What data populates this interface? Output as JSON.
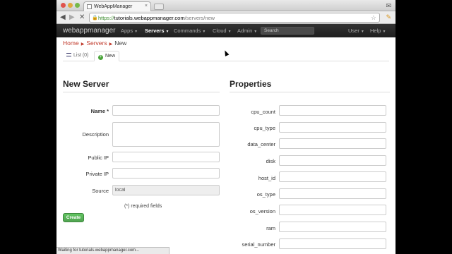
{
  "browser": {
    "tab_title": "WebAppManager",
    "tab_close": "×",
    "url_scheme": "https://",
    "url_host": "tutorials.webappmanager.com",
    "url_path": "/servers/new",
    "back_glyph": "◀",
    "forward_glyph": "▶",
    "stop_glyph": "✕",
    "lock_glyph": "🔒",
    "star_glyph": "☆",
    "ext_glyph": "✎",
    "person_glyph": "✉"
  },
  "navbar": {
    "brand": "webappmanager",
    "items": [
      {
        "label": "Apps",
        "caret": "▼",
        "active": false
      },
      {
        "label": "Servers",
        "caret": "▼",
        "active": true
      },
      {
        "label": "Commands",
        "caret": "▼",
        "active": false
      },
      {
        "label": "Cloud",
        "caret": "▼",
        "active": false
      },
      {
        "label": "Admin",
        "caret": "▼",
        "active": false
      }
    ],
    "search_placeholder": "Search",
    "user": {
      "label": "User",
      "caret": "▼"
    },
    "help": {
      "label": "Help",
      "caret": "▼"
    }
  },
  "breadcrumb": {
    "home": "Home",
    "servers": "Servers",
    "current": "New",
    "separator": "▶"
  },
  "tabs": {
    "list": "List (0)",
    "new": "New",
    "new_icon": "+"
  },
  "form": {
    "title": "New Server",
    "fields": {
      "name": {
        "label": "Name *",
        "value": ""
      },
      "description": {
        "label": "Description",
        "value": ""
      },
      "public_ip": {
        "label": "Public IP",
        "value": ""
      },
      "private_ip": {
        "label": "Private IP",
        "value": ""
      },
      "source": {
        "label": "Source",
        "value": "local"
      }
    },
    "required_note": "(*) required fields",
    "submit": "Create"
  },
  "properties": {
    "title": "Properties",
    "fields": [
      {
        "label": "cpu_count",
        "value": ""
      },
      {
        "label": "cpu_type",
        "value": ""
      },
      {
        "label": "data_center",
        "value": ""
      },
      {
        "label": "disk",
        "value": ""
      },
      {
        "label": "host_id",
        "value": ""
      },
      {
        "label": "os_type",
        "value": ""
      },
      {
        "label": "os_version",
        "value": ""
      },
      {
        "label": "ram",
        "value": ""
      },
      {
        "label": "serial_number",
        "value": ""
      }
    ]
  },
  "status_bar": "Waiting for tutorials.webappmanager.com..."
}
